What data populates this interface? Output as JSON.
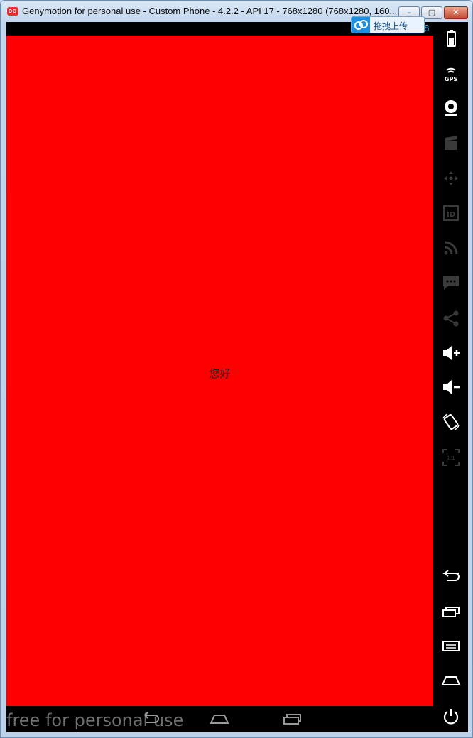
{
  "window": {
    "title": "Genymotion for personal use - Custom Phone - 4.2.2 - API 17 - 768x1280 (768x1280, 160...",
    "min_glyph": "–",
    "max_glyph": "▢",
    "close_glyph": "✕"
  },
  "statusbar": {
    "value": "8"
  },
  "screen": {
    "text": "您好",
    "background": "#ff0000"
  },
  "navbar": {
    "watermark": "free for personal use"
  },
  "upload": {
    "label": "拖拽上传"
  },
  "toolbar": {
    "items": [
      "battery-icon",
      "gps-icon",
      "webcam-icon",
      "screencast-icon",
      "dpad-icon",
      "device-id-icon",
      "rss-icon",
      "sms-icon",
      "share-icon",
      "volume-up-icon",
      "volume-down-icon",
      "rotate-icon",
      "scale-1-1-icon",
      "back-icon",
      "recent-apps-icon",
      "menu-icon",
      "home-icon",
      "power-icon"
    ],
    "gps_label": "GPS",
    "id_label": "ID",
    "scale_label": "1:1"
  },
  "colors": {
    "accent": "#33b5e5",
    "screen": "#ff0000",
    "frame": "#000000"
  }
}
